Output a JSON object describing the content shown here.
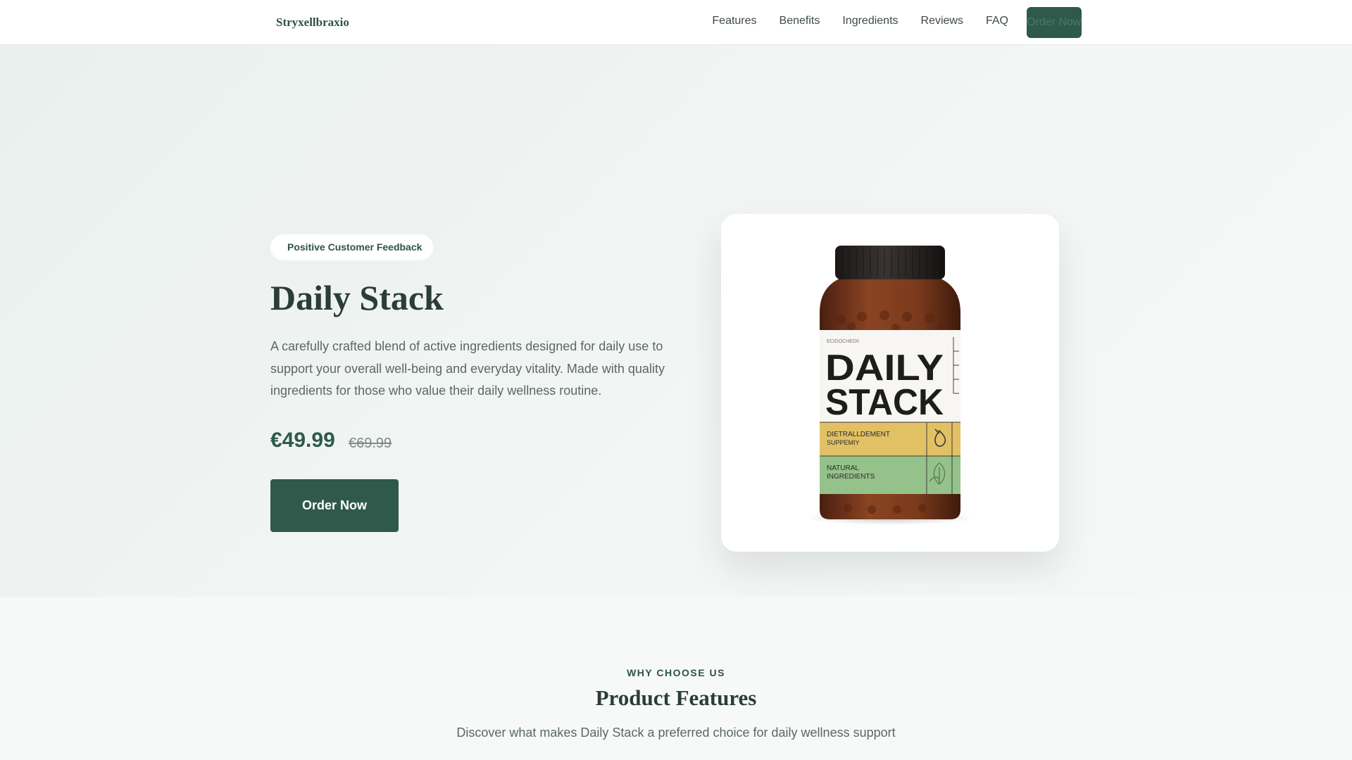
{
  "nav": {
    "brand": "Stryxellbraxio",
    "links": [
      "Features",
      "Benefits",
      "Ingredients",
      "Reviews",
      "FAQ"
    ],
    "cta": "Order Now"
  },
  "hero": {
    "badge": "Positive Customer Feedback",
    "title": "Daily Stack",
    "description": "A carefully crafted blend of active ingredients designed for daily use to support your overall well-being and everyday vitality. Made with quality ingredients for those who value their daily wellness routine.",
    "price": "€49.99",
    "old_price": "€69.99",
    "cta": "Order Now"
  },
  "product_image": {
    "label_top": "ECIDOCHEDII",
    "label_title_1": "DAILY",
    "label_title_2": "STACK",
    "band1_line1": "DIETRALLDEMENT",
    "band1_line2": "SUPPEMIY",
    "band2_line1": "NATURAL",
    "band2_line2": "INGREDIENTS",
    "colors": {
      "lid": "#2a2624",
      "glass": "#7a3a1c",
      "label": "#f7f6f3",
      "band_yellow": "#e2c064",
      "band_green": "#95c18a"
    }
  },
  "features_section": {
    "eyebrow": "WHY CHOOSE US",
    "title": "Product Features",
    "subtitle": "Discover what makes Daily Stack a preferred choice for daily wellness support"
  },
  "theme": {
    "accent": "#2e594b",
    "text_dark": "#2b3d37",
    "text_muted": "#5b6864"
  }
}
